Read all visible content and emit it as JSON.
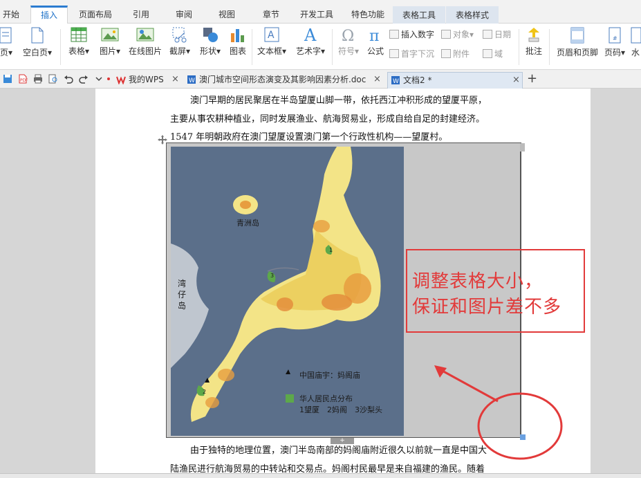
{
  "ribbon_tabs": [
    "开始",
    "插入",
    "页面布局",
    "引用",
    "审阅",
    "视图",
    "章节",
    "开发工具",
    "特色功能",
    "表格工具",
    "表格样式"
  ],
  "ribbon": {
    "page_partial": "页",
    "blank_page": "空白页",
    "table": "表格",
    "picture": "图片",
    "online_picture": "在线图片",
    "screenshot": "截屏",
    "shape": "形状",
    "chart": "图表",
    "textbox": "文本框",
    "wordart": "艺术字",
    "symbol": "符号",
    "formula": "公式",
    "insert_number": "插入数字",
    "object": "对象",
    "date": "日期",
    "dropcap": "首字下沉",
    "attachment": "附件",
    "field": "域",
    "annotation": "批注",
    "header_footer": "页眉和页脚",
    "page_number": "页码",
    "watermark_partial": "水",
    "dropdown_arrow": "▾"
  },
  "doc_tabs": {
    "wps": "我的WPS",
    "doc1": "澳门城市空间形态演变及其影响因素分析.doc",
    "doc2": "文档2 *",
    "close": "×",
    "new": "+"
  },
  "document": {
    "line1": "澳门早期的居民聚居在半岛望厦山脚一带，依托西江冲积形成的望厦平原，",
    "line2": "主要从事农耕种植业，同时发展渔业、航海贸易业，形成自给自足的封建经济。",
    "line3": "1547 年明朝政府在澳门望厦设置澳门第一个行政性机构——望厦村。",
    "line4": "由于独特的地理位置，澳门半岛南部的妈阁庙附近很久以前就一直是中国大",
    "line5": "陆渔民进行航海贸易的中转站和交易点。妈阁村民最早是来自福建的渔民。随着"
  },
  "map": {
    "island_qingzhou": "青洲岛",
    "island_wanzai": "湾仔岛",
    "legend_temple": "中国庙宇：妈阁庙",
    "legend_settlement": "华人居民点分布",
    "legend_items": "1望厦　2妈阁　3沙梨头",
    "marker_1": "1",
    "marker_2": "2",
    "marker_3": "3"
  },
  "annotation": {
    "line1": "调整表格大小，",
    "line2": "保证和图片差不多"
  },
  "colors": {
    "accent_blue": "#2b7bd0",
    "annotation_red": "#e23a3a",
    "map_sea": "#5b6f8a",
    "map_land": "#f3e487"
  }
}
